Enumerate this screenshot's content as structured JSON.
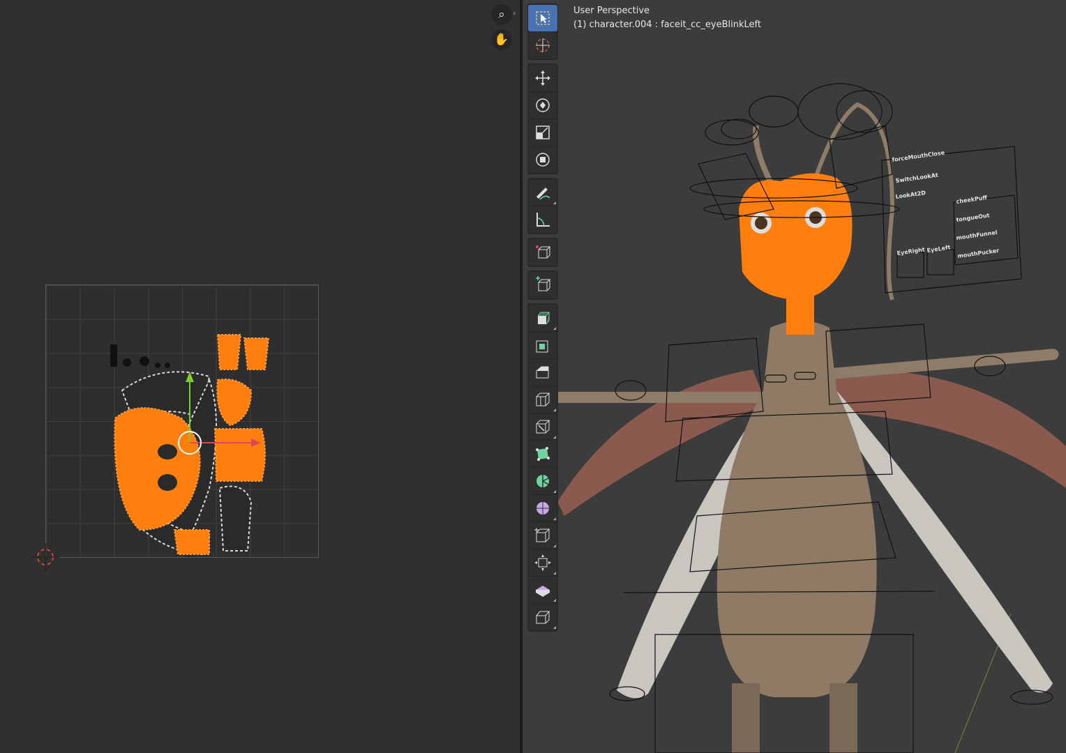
{
  "viewport": {
    "view_name": "User Perspective",
    "object_info": "(1) character.004 : faceit_cc_eyeBlinkLeft"
  },
  "rig_labels": {
    "force_mouth_close": "forceMouthClose",
    "switch_look_at": "SwitchLookAt",
    "look_at_2d": "LookAt2D",
    "cheek_puff": "cheekPuff",
    "tongue_out": "tongueOut",
    "mouth_funnel": "mouthFunnel",
    "mouth_pucker": "mouthPucker",
    "eye_right": "EyeRight",
    "eye_left": "EyeLeft"
  },
  "colors": {
    "selection": "#ff7f0e",
    "active_tool": "#4772b3",
    "editor_bg": "#303030",
    "viewport_bg": "#3c3c3c"
  },
  "uv_nav_icons": [
    "zoom-icon",
    "pan-hand-icon"
  ],
  "tools": [
    "select-box-tool-icon",
    "cursor-tool-icon",
    "move-tool-icon",
    "rotate-tool-icon",
    "scale-tool-icon",
    "transform-tool-icon",
    "annotate-tool-icon",
    "measure-tool-icon",
    "add-cube-tool-icon",
    "add-cube-alt-tool-icon",
    "extrude-region-tool-icon",
    "inset-faces-tool-icon",
    "bevel-tool-icon",
    "loop-cut-tool-icon",
    "knife-tool-icon",
    "poly-build-tool-icon",
    "spin-tool-icon",
    "smooth-tool-icon",
    "edge-slide-tool-icon",
    "shrink-fatten-tool-icon",
    "shear-tool-icon",
    "rip-region-tool-icon"
  ]
}
